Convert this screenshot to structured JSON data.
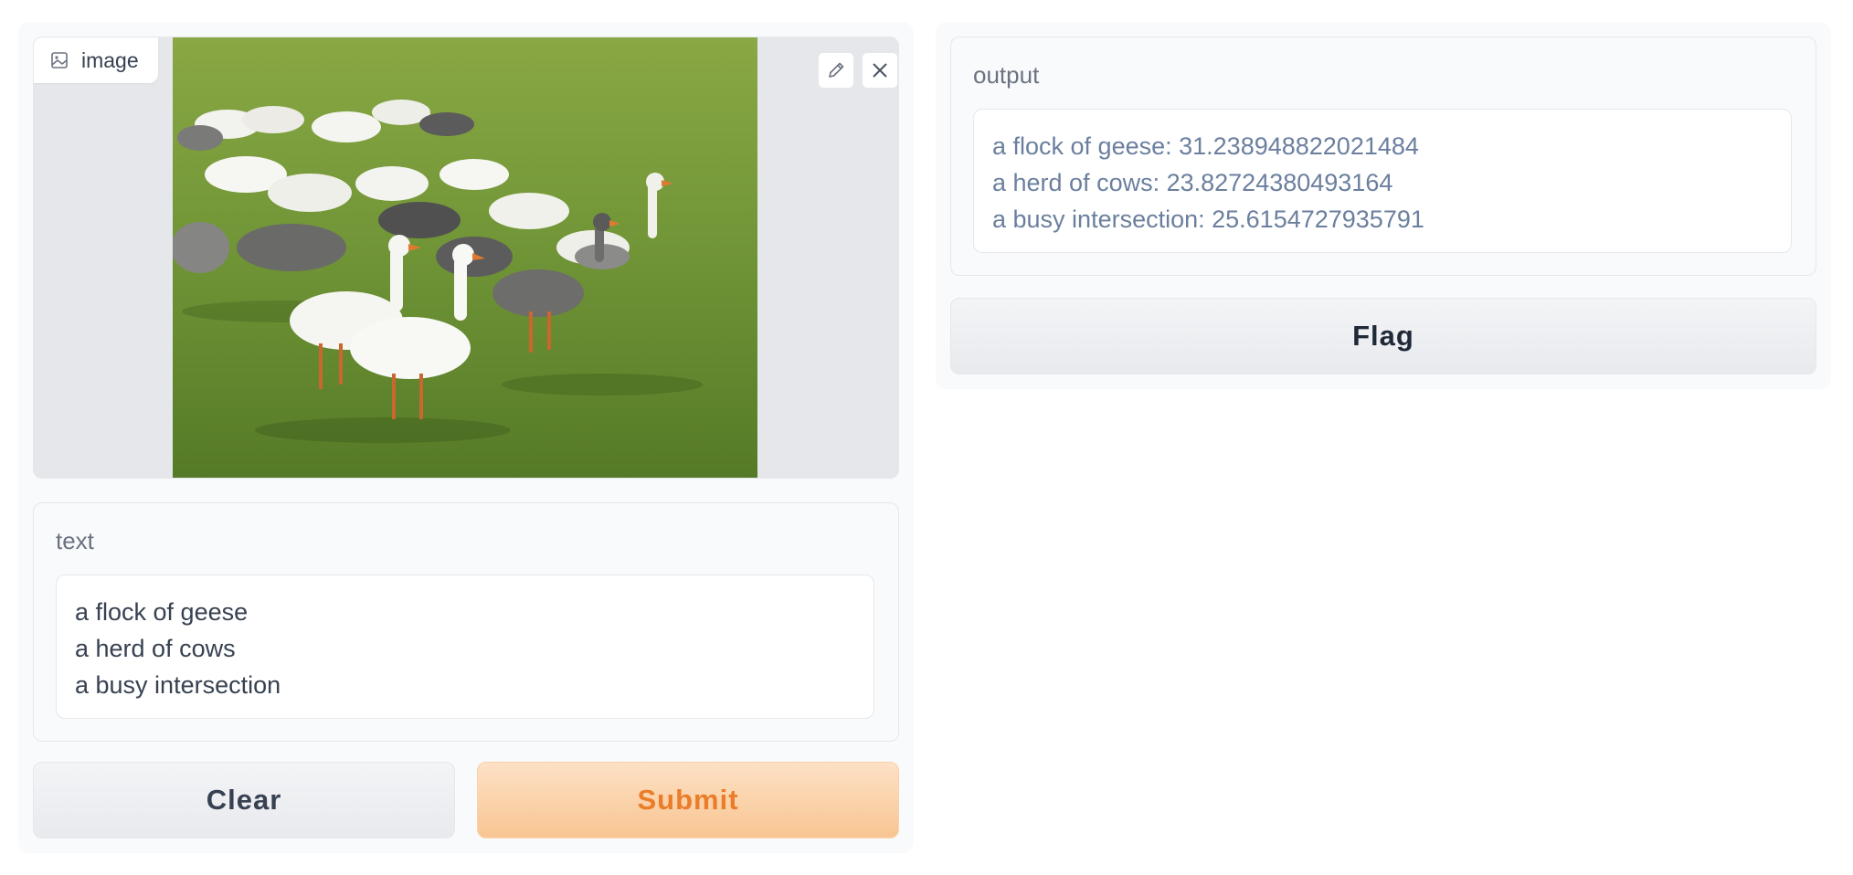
{
  "image_input": {
    "label": "image",
    "icons": {
      "label": "image-icon",
      "edit": "pencil-icon",
      "close": "close-icon"
    }
  },
  "text_input": {
    "label": "text",
    "lines": [
      "a flock of geese",
      "a herd of cows",
      "a busy intersection"
    ]
  },
  "buttons": {
    "clear": "Clear",
    "submit": "Submit",
    "flag": "Flag"
  },
  "output": {
    "label": "output",
    "lines": [
      "a flock of geese: 31.238948822021484",
      "a herd of cows: 23.82724380493164",
      "a busy intersection: 25.6154727935791"
    ]
  },
  "colors": {
    "accent": "#ea7c2a",
    "submit_bg": "#f8c592",
    "panel_bg": "#f9fafb"
  }
}
